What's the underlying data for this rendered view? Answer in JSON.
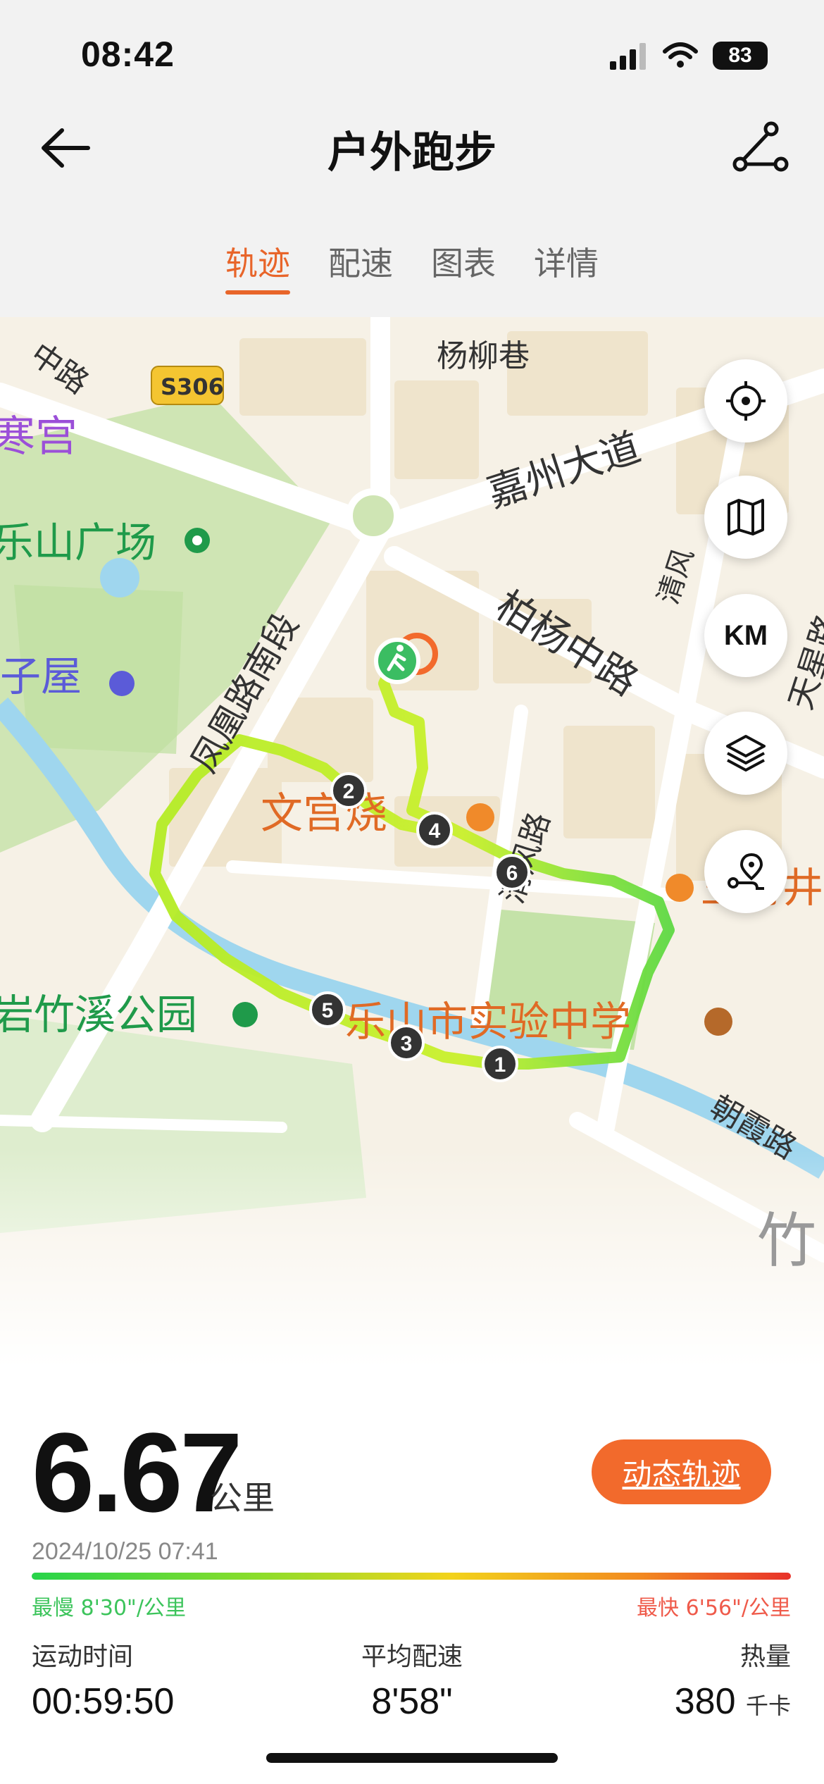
{
  "status_bar": {
    "time": "08:42",
    "battery": "83"
  },
  "header": {
    "title": "户外跑步"
  },
  "tabs": [
    {
      "label": "轨迹",
      "active": true
    },
    {
      "label": "配速",
      "active": false
    },
    {
      "label": "图表",
      "active": false
    },
    {
      "label": "详情",
      "active": false
    }
  ],
  "map": {
    "labels": {
      "road_top_left": "中路",
      "s306": "S306",
      "yangliu": "杨柳巷",
      "jiazhou": "嘉州大道",
      "hangong": "寒宫",
      "leshan_square": "乐山广场",
      "baiyang": "柏杨中路",
      "qingfeng": "清风",
      "tianxing": "天星路",
      "fenghuang": "凤凰路南段",
      "zi_house": "子屋",
      "wengong": "文宫烧",
      "qingfeng_road": "清风路",
      "wangfu": "王府井",
      "zhuxi_park": "岩竹溪公园",
      "school": "乐山市实验中学",
      "zhaoxia": "朝霞路",
      "zhu": "竹"
    },
    "markers": [
      "1",
      "2",
      "3",
      "4",
      "5",
      "6"
    ],
    "buttons": {
      "locate": "locate-icon",
      "map_style": "map-icon",
      "km": "KM",
      "layers": "layers-icon",
      "route": "route-icon"
    }
  },
  "summary": {
    "distance": "6.67",
    "distance_unit": "公里",
    "replay_label": "动态轨迹",
    "datetime": "2024/10/25 07:41",
    "slowest": "最慢 8'30\"/公里",
    "fastest": "最快 6'56\"/公里",
    "stats": [
      {
        "label": "运动时间",
        "value": "00:59:50",
        "unit": ""
      },
      {
        "label": "平均配速",
        "value": "8'58\"",
        "unit": ""
      },
      {
        "label": "热量",
        "value": "380",
        "unit": "千卡"
      }
    ]
  },
  "colors": {
    "accent": "#e8652a",
    "route_green": "#c8f02a",
    "slow": "#3cc45b",
    "fast": "#ef5a4a"
  }
}
